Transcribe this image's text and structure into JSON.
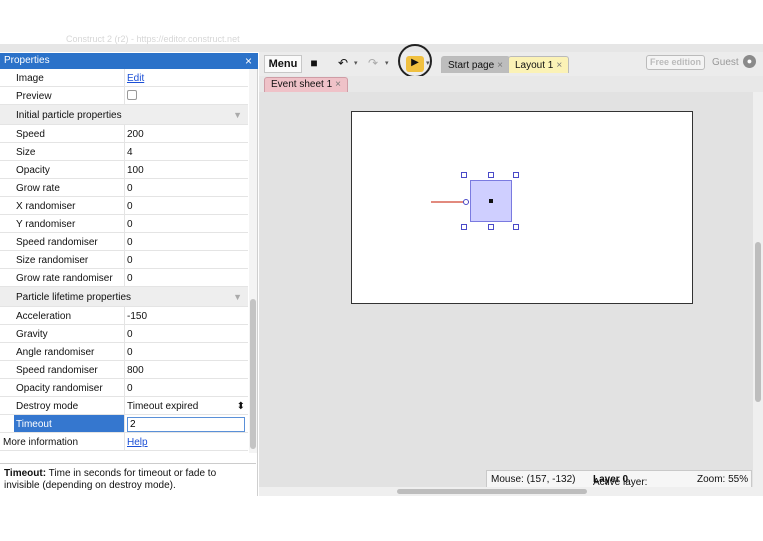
{
  "browser": {
    "tab_text": "Construct 2 (r2) - https://editor.construct.net"
  },
  "properties": {
    "title": "Properties",
    "close_glyph": "×",
    "rows": [
      {
        "key": "Image",
        "value": "Edit",
        "kind": "link"
      },
      {
        "key": "Preview",
        "value": "",
        "kind": "checkbox"
      }
    ],
    "section1": {
      "label": "Initial particle properties",
      "arrow": "▼"
    },
    "initial": [
      {
        "key": "Speed",
        "value": "200"
      },
      {
        "key": "Size",
        "value": "4"
      },
      {
        "key": "Opacity",
        "value": "100"
      },
      {
        "key": "Grow rate",
        "value": "0"
      },
      {
        "key": "X randomiser",
        "value": "0"
      },
      {
        "key": "Y randomiser",
        "value": "0"
      },
      {
        "key": "Speed randomiser",
        "value": "0"
      },
      {
        "key": "Size randomiser",
        "value": "0"
      },
      {
        "key": "Grow rate randomiser",
        "value": "0"
      }
    ],
    "section2": {
      "label": "Particle lifetime properties",
      "arrow": "▼"
    },
    "lifetime": [
      {
        "key": "Acceleration",
        "value": "-150"
      },
      {
        "key": "Gravity",
        "value": "0"
      },
      {
        "key": "Angle randomiser",
        "value": "0"
      },
      {
        "key": "Speed randomiser",
        "value": "800"
      },
      {
        "key": "Opacity randomiser",
        "value": "0"
      }
    ],
    "destroy_mode": {
      "key": "Destroy mode",
      "value": "Timeout expired",
      "arrow": "⬍"
    },
    "timeout": {
      "key": "Timeout",
      "value": "2"
    },
    "more_info": {
      "key": "More information",
      "value": "Help"
    },
    "description": {
      "title": "Timeout:",
      "text": "Time in seconds for timeout or fade to invisible (depending on destroy mode)."
    }
  },
  "toolbar": {
    "menu_label": "Menu",
    "save_icon": "■",
    "undo_icon": "↶",
    "redo_icon": "↷",
    "dropdown_glyph": "▾",
    "play_icon": "▶",
    "tabs": [
      {
        "label": "Start page",
        "close": "×"
      },
      {
        "label": "Layout 1",
        "close": "×"
      }
    ],
    "free_edition_label": "Free edition",
    "guest_label": "Guest",
    "user_icon": "●"
  },
  "subtabs": {
    "event_sheet_label": "Event sheet 1",
    "close": "×"
  },
  "status": {
    "mouse_label": "Mouse: (157, -132)",
    "layer_prefix": "Active layer:",
    "layer_value": "Layer 0",
    "zoom_label": "Zoom: 55%"
  },
  "colors": {
    "header_blue": "#2b72c9",
    "play_yellow": "#f0c040",
    "event_tab_pink": "#efc2c8",
    "layout_tab_yellow": "#fbf2b6",
    "sprite_fill": "#cfcfff"
  }
}
